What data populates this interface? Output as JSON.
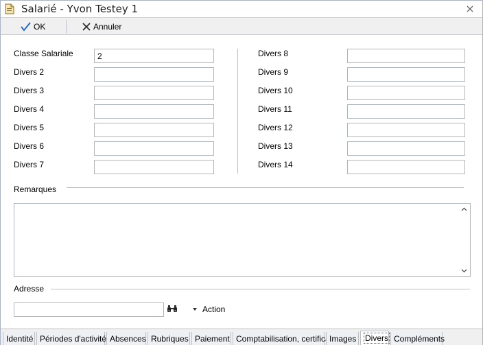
{
  "window": {
    "title": "Salarié - Yvon Testey 1"
  },
  "toolbar": {
    "ok_label": "OK",
    "cancel_label": "Annuler"
  },
  "form": {
    "left": [
      {
        "label": "Classe Salariale",
        "value": "2"
      },
      {
        "label": "Divers 2",
        "value": ""
      },
      {
        "label": "Divers 3",
        "value": ""
      },
      {
        "label": "Divers 4",
        "value": ""
      },
      {
        "label": "Divers 5",
        "value": ""
      },
      {
        "label": "Divers 6",
        "value": ""
      },
      {
        "label": "Divers 7",
        "value": ""
      }
    ],
    "right": [
      {
        "label": "Divers 8",
        "value": ""
      },
      {
        "label": "Divers 9",
        "value": ""
      },
      {
        "label": "Divers 10",
        "value": ""
      },
      {
        "label": "Divers 11",
        "value": ""
      },
      {
        "label": "Divers 12",
        "value": ""
      },
      {
        "label": "Divers 13",
        "value": ""
      },
      {
        "label": "Divers 14",
        "value": ""
      }
    ],
    "remarks_label": "Remarques",
    "remarks_value": "",
    "address_label": "Adresse",
    "address_value": "",
    "action_label": "Action"
  },
  "tabs": [
    {
      "label": "Identité",
      "active": false
    },
    {
      "label": "Périodes d'activité",
      "active": false
    },
    {
      "label": "Absences",
      "active": false
    },
    {
      "label": "Rubriques",
      "active": false
    },
    {
      "label": "Paiement",
      "active": false
    },
    {
      "label": "Comptabilisation, certificat",
      "active": false
    },
    {
      "label": "Images",
      "active": false
    },
    {
      "label": "Divers",
      "active": true
    },
    {
      "label": "Compléments",
      "active": false
    }
  ],
  "icons": {
    "app": "document-icon",
    "close": "close-icon",
    "ok": "checkmark-icon",
    "cancel": "cross-icon",
    "search": "binoculars-icon",
    "action": "caret-down-icon"
  },
  "colors": {
    "accent": "#2a6ac9",
    "border": "#aeb5bf"
  }
}
